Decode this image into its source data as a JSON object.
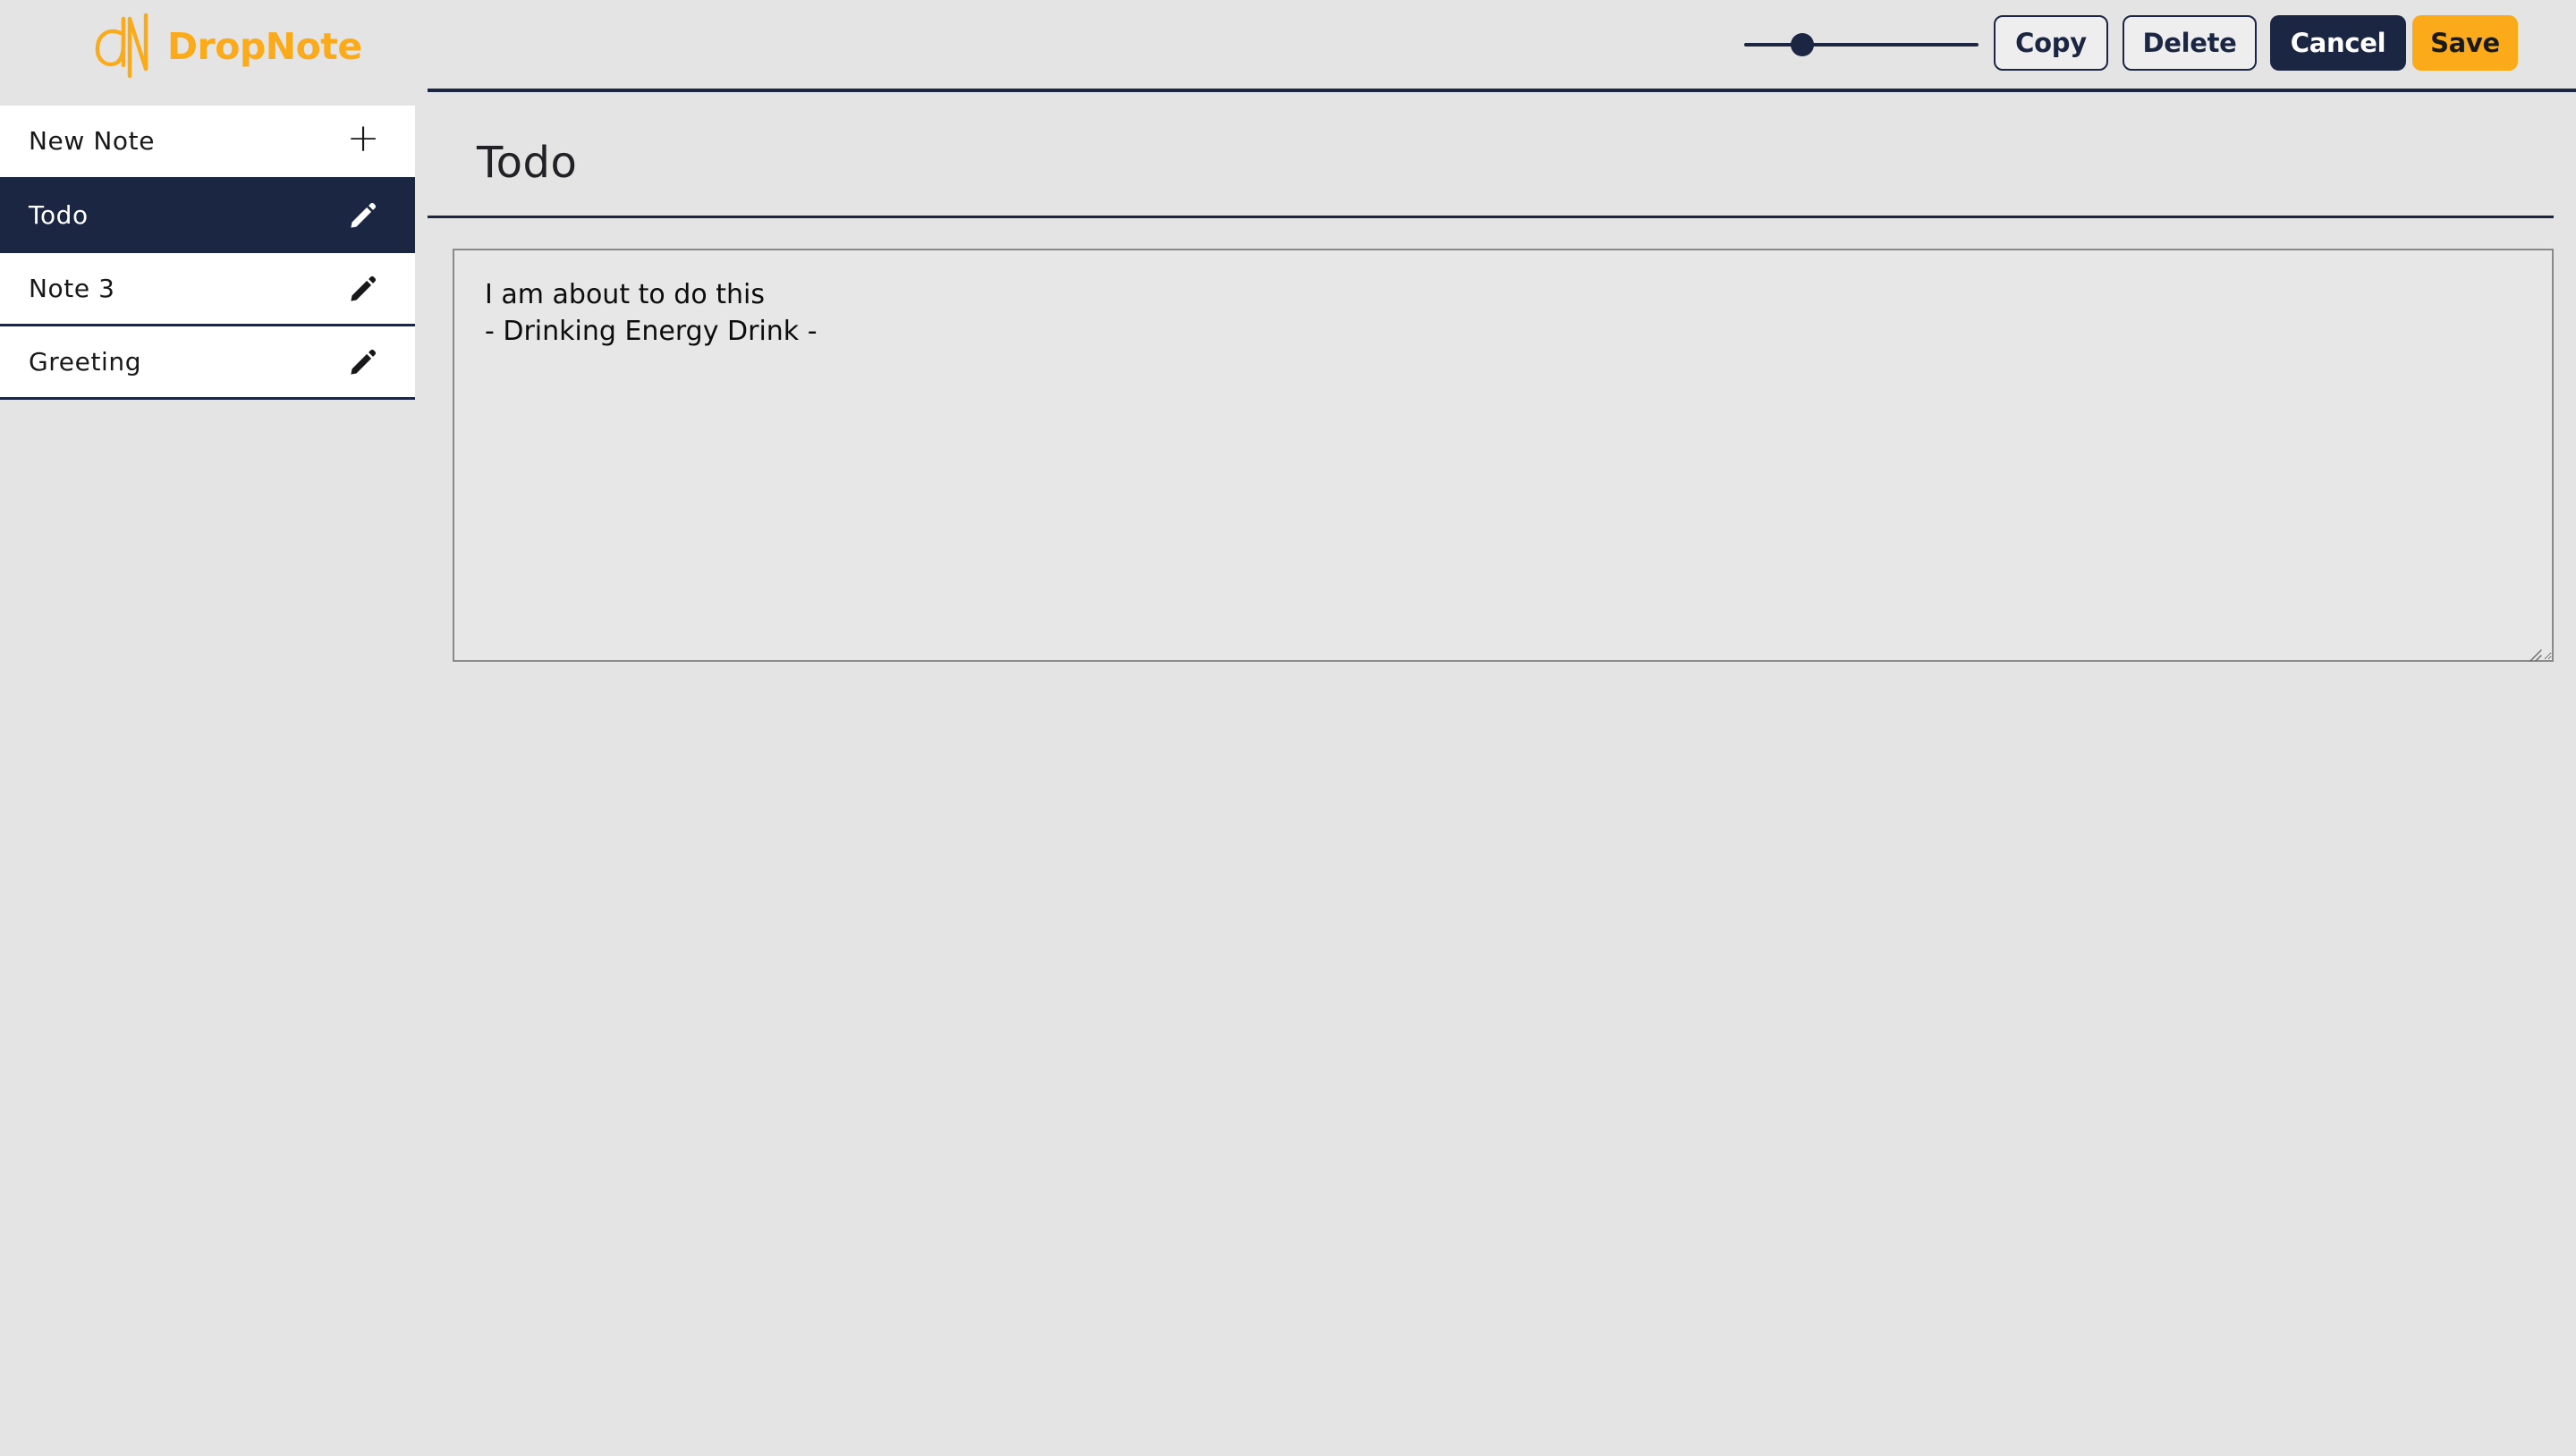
{
  "app": {
    "brand_name": "DropNote",
    "brand_mark_icon": "dn-monogram-logo",
    "accent_color": "#fbaa19",
    "navy_color": "#1b2642",
    "background_color": "#e4e4e4"
  },
  "header": {
    "slider": {
      "name": "zoom-slider",
      "value_percent": 22,
      "track_color": "#1b2642",
      "thumb_color": "#1b2642"
    },
    "buttons": {
      "copy": "Copy",
      "delete": "Delete",
      "cancel": "Cancel",
      "save": "Save"
    }
  },
  "sidebar": {
    "new_note": {
      "label": "New Note",
      "icon": "plus-icon",
      "icon_glyph": "+"
    },
    "items": [
      {
        "label": "Todo",
        "icon": "pencil-icon",
        "selected": true
      },
      {
        "label": "Note 3",
        "icon": "pencil-icon",
        "selected": false
      },
      {
        "label": "Greeting",
        "icon": "pencil-icon",
        "selected": false
      }
    ]
  },
  "main": {
    "title": "Todo",
    "editor": {
      "content": "I am about to do this\n- Drinking Energy Drink -",
      "placeholder": "",
      "resize_handle_icon": "resize-grip-icon"
    }
  }
}
